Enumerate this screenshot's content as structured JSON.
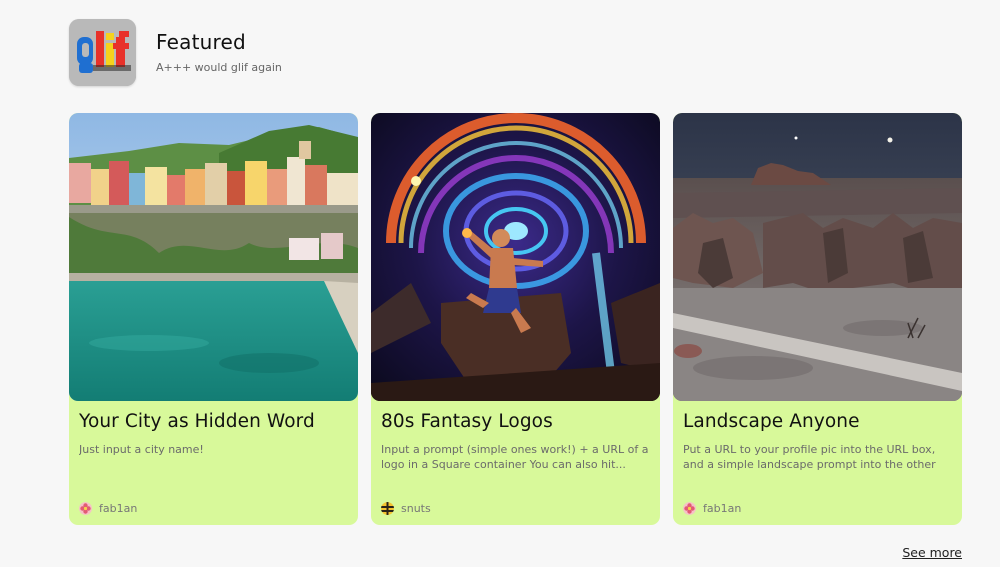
{
  "section": {
    "title": "Featured",
    "subtitle": "A+++ would glif again",
    "logo_icon": "glif-logo"
  },
  "cards": [
    {
      "title": "Your City as Hidden Word",
      "description": "Just input a city name!",
      "author": "fab1an",
      "avatar_icon": "flower-avatar",
      "image": "coastal-town-lagoon"
    },
    {
      "title": "80s Fantasy Logos",
      "description": "Input a prompt (simple ones work!) + a URL of a logo in a Square container You can also hit...",
      "author": "snuts",
      "avatar_icon": "bee-avatar",
      "image": "cosmic-warrior-vortex"
    },
    {
      "title": "Landscape Anyone",
      "description": "Put a URL to your profile pic into the URL box, and a simple landscape prompt into the other",
      "author": "fab1an",
      "avatar_icon": "flower-avatar",
      "image": "desert-night-landscape"
    }
  ],
  "footer": {
    "see_more_label": "See more"
  },
  "colors": {
    "card_background": "#d8f99a",
    "page_background": "#f7f7f7"
  }
}
